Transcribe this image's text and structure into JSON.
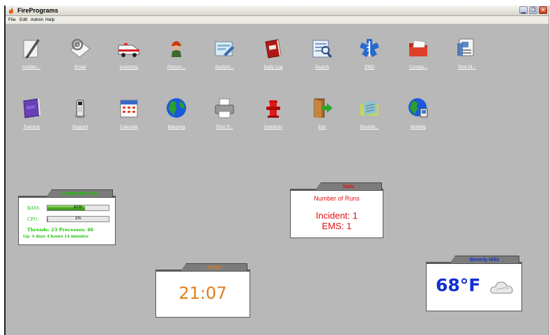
{
  "window": {
    "title": "FirePrograms",
    "minimize": "▁",
    "restore": "❐",
    "close": "✕"
  },
  "menu": [
    "File",
    "Edit",
    "Admin",
    "Help"
  ],
  "icons_row1": [
    {
      "label": "Inciden...",
      "icon": "incident-icon"
    },
    {
      "label": "Email",
      "icon": "email-icon"
    },
    {
      "label": "Inventory",
      "icon": "inventory-icon"
    },
    {
      "label": "Person...",
      "icon": "personnel-icon"
    },
    {
      "label": "System...",
      "icon": "system-icon"
    },
    {
      "label": "Daily Log",
      "icon": "daily-log-icon"
    },
    {
      "label": "Search",
      "icon": "search-icon"
    },
    {
      "label": "EMS",
      "icon": "ems-icon"
    },
    {
      "label": "Compa...",
      "icon": "company-icon"
    },
    {
      "label": "Risk M...",
      "icon": "risk-management-icon"
    }
  ],
  "icons_row2": [
    {
      "label": "Training",
      "icon": "training-icon"
    },
    {
      "label": "Support",
      "icon": "support-icon"
    },
    {
      "label": "Calendar",
      "icon": "calendar-icon"
    },
    {
      "label": "Mapping",
      "icon": "mapping-icon"
    },
    {
      "label": "Print P...",
      "icon": "print-icon"
    },
    {
      "label": "Hydrants",
      "icon": "hydrant-icon"
    },
    {
      "label": "Exit",
      "icon": "exit-icon"
    },
    {
      "label": "Docklet...",
      "icon": "docklet-icon"
    },
    {
      "label": "Mobility",
      "icon": "mobility-icon"
    }
  ],
  "system_monitor": {
    "title": "System Monitor",
    "ram_label": "RAM:",
    "ram_value": "61%",
    "ram_fraction": 0.61,
    "cpu_label": "CPU:",
    "cpu_value": "1%",
    "cpu_fraction": 0.01,
    "threads_line": "Threads: 23 Processes: 46",
    "uptime_line": "Up: 4 days  4 hours  14 minutes"
  },
  "stats": {
    "title": "Stats",
    "heading": "Number of Runs",
    "incident": "Incident: 1",
    "ems": "EMS: 1"
  },
  "clock": {
    "title": "Clock",
    "time": "21:07"
  },
  "weather": {
    "title": "Beverly Hills",
    "temperature": "68°F",
    "condition_icon": "cloudy-icon"
  },
  "colors": {
    "desktop": "#b8b8b8",
    "monitor_green": "#16c400",
    "stats_red": "#e01010",
    "clock_orange": "#e27d16",
    "weather_blue": "#1230d0"
  }
}
